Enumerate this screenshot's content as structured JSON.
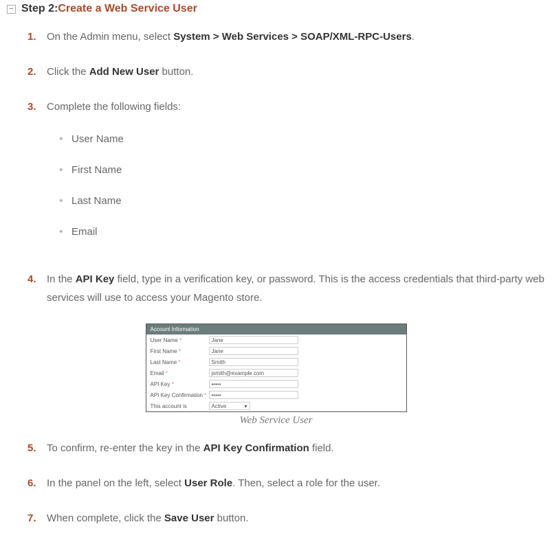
{
  "header": {
    "collapse": "−",
    "step_label": "Step 2: ",
    "step_title": "Create a Web Service User"
  },
  "steps": [
    {
      "num": "1.",
      "pre": "On the Admin menu, select ",
      "bold": "System > Web Services > SOAP/XML-RPC-Users",
      "post": "."
    },
    {
      "num": "2.",
      "pre": "Click the ",
      "bold": "Add New User",
      "post": " button."
    },
    {
      "num": "3.",
      "pre": "Complete the following fields:",
      "fields": [
        "User Name",
        "First Name",
        "Last Name",
        "Email"
      ]
    },
    {
      "num": "4.",
      "pre": "In the ",
      "bold": "API Key",
      "post": " field, type in a verification key, or password. This is the access credentials that third-party web services will use to access your Magento store."
    },
    {
      "num": "5.",
      "pre": "To confirm, re-enter the key in the ",
      "bold": "API Key Confirmation",
      "post": " field."
    },
    {
      "num": "6.",
      "pre": "In the panel on the left, select ",
      "bold": "User Role",
      "post": ". Then, select a role for the user."
    },
    {
      "num": "7.",
      "pre": "When complete, click the ",
      "bold": "Save User",
      "post": " button."
    }
  ],
  "figure": {
    "header": "Account Information",
    "rows": [
      {
        "label": "User Name",
        "req": "*",
        "value": "Jane",
        "type": "text"
      },
      {
        "label": "First Name",
        "req": "*",
        "value": "Jane",
        "type": "text"
      },
      {
        "label": "Last Name",
        "req": "*",
        "value": "Smith",
        "type": "text"
      },
      {
        "label": "Email",
        "req": "*",
        "value": "jsmith@example.com",
        "type": "text"
      },
      {
        "label": "API Key",
        "req": "*",
        "value": "•••••",
        "type": "text"
      },
      {
        "label": "API Key Confirmation",
        "req": "*",
        "value": "•••••",
        "type": "text"
      },
      {
        "label": "This account is",
        "req": "",
        "value": "Active",
        "type": "select"
      }
    ],
    "caption": "Web Service User"
  }
}
